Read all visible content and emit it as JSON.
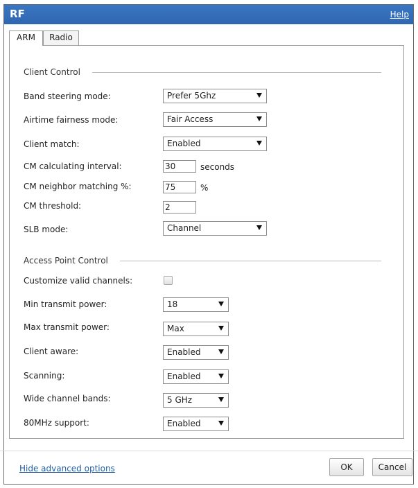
{
  "window": {
    "title": "RF",
    "help_label": "Help"
  },
  "tabs": [
    {
      "label": "ARM",
      "active": true
    },
    {
      "label": "Radio",
      "active": false
    }
  ],
  "client_control": {
    "heading": "Client Control",
    "band_steering": {
      "label": "Band steering mode:",
      "value": "Prefer 5Ghz"
    },
    "airtime_fairness": {
      "label": "Airtime fairness mode:",
      "value": "Fair Access"
    },
    "client_match": {
      "label": "Client match:",
      "value": "Enabled"
    },
    "cm_interval": {
      "label": "CM calculating interval:",
      "value": "30",
      "unit": "seconds"
    },
    "cm_neighbor": {
      "label": "CM neighbor matching %:",
      "value": "75",
      "unit": "%"
    },
    "cm_threshold": {
      "label": "CM threshold:",
      "value": "2"
    },
    "slb_mode": {
      "label": "SLB mode:",
      "value": "Channel"
    }
  },
  "ap_control": {
    "heading": "Access Point Control",
    "customize_channels": {
      "label": "Customize valid channels:",
      "checked": false
    },
    "min_power": {
      "label": "Min transmit power:",
      "value": "18"
    },
    "max_power": {
      "label": "Max transmit power:",
      "value": "Max"
    },
    "client_aware": {
      "label": "Client aware:",
      "value": "Enabled"
    },
    "scanning": {
      "label": "Scanning:",
      "value": "Enabled"
    },
    "wide_bands": {
      "label": "Wide channel bands:",
      "value": "5 GHz"
    },
    "support_80mhz": {
      "label": "80MHz support:",
      "value": "Enabled"
    }
  },
  "footer": {
    "hide_advanced": "Hide advanced options",
    "ok": "OK",
    "cancel": "Cancel"
  },
  "colors": {
    "titlebar": "#3070b8",
    "link": "#1f5fa8"
  }
}
